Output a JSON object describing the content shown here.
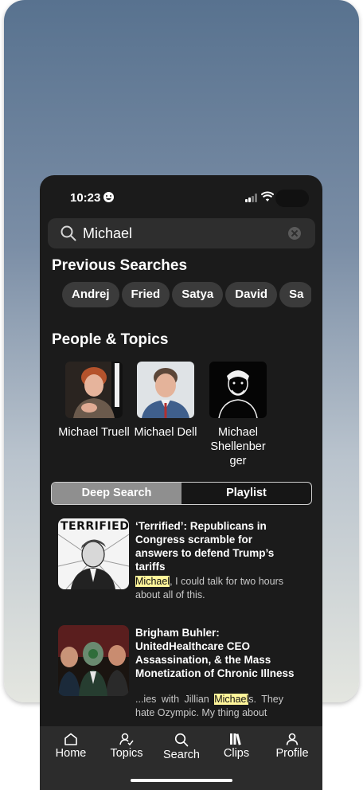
{
  "status_bar": {
    "time": "10:23"
  },
  "search": {
    "value": "Michael",
    "icon": "search-icon",
    "clear_icon": "clear-icon"
  },
  "previous_searches": {
    "title": "Previous Searches",
    "chips": [
      "Andrej",
      "Fried",
      "Satya",
      "David",
      "Sa"
    ]
  },
  "people_topics": {
    "title": "People & Topics",
    "people": [
      {
        "name": "Michael Truell"
      },
      {
        "name": "Michael Dell"
      },
      {
        "name": "Michael Shellenber ger"
      }
    ]
  },
  "segmented": {
    "active": "Deep Search",
    "inactive": "Playlist"
  },
  "results": [
    {
      "title": "‘Terrified’: Republicans in Congress scramble for answers to defend Trump’s tariffs",
      "thumb_text": "TERRIFIED",
      "snippet_pre": "",
      "snippet_highlight": "Michael",
      "snippet_post": ", I could talk for two hours about all of this."
    },
    {
      "title": "Brigham Buhler: UnitedHealthcare CEO Assassination, & the Mass Monetization of Chronic Illness",
      "snippet_pre": "...ies with Jillian ",
      "snippet_highlight": "Michael",
      "snippet_post": "s. They hate Ozympic. My thing about"
    }
  ],
  "tab_bar": {
    "tabs": [
      {
        "label": "Home",
        "icon": "home-icon"
      },
      {
        "label": "Topics",
        "icon": "topics-icon"
      },
      {
        "label": "Search",
        "icon": "search-icon"
      },
      {
        "label": "Clips",
        "icon": "clips-icon"
      },
      {
        "label": "Profile",
        "icon": "profile-icon"
      }
    ]
  },
  "colors": {
    "highlight": "#fff59a",
    "background": "#1b1b1b",
    "chip": "#3b3b3b",
    "tab_bar": "#2c2c2c"
  }
}
